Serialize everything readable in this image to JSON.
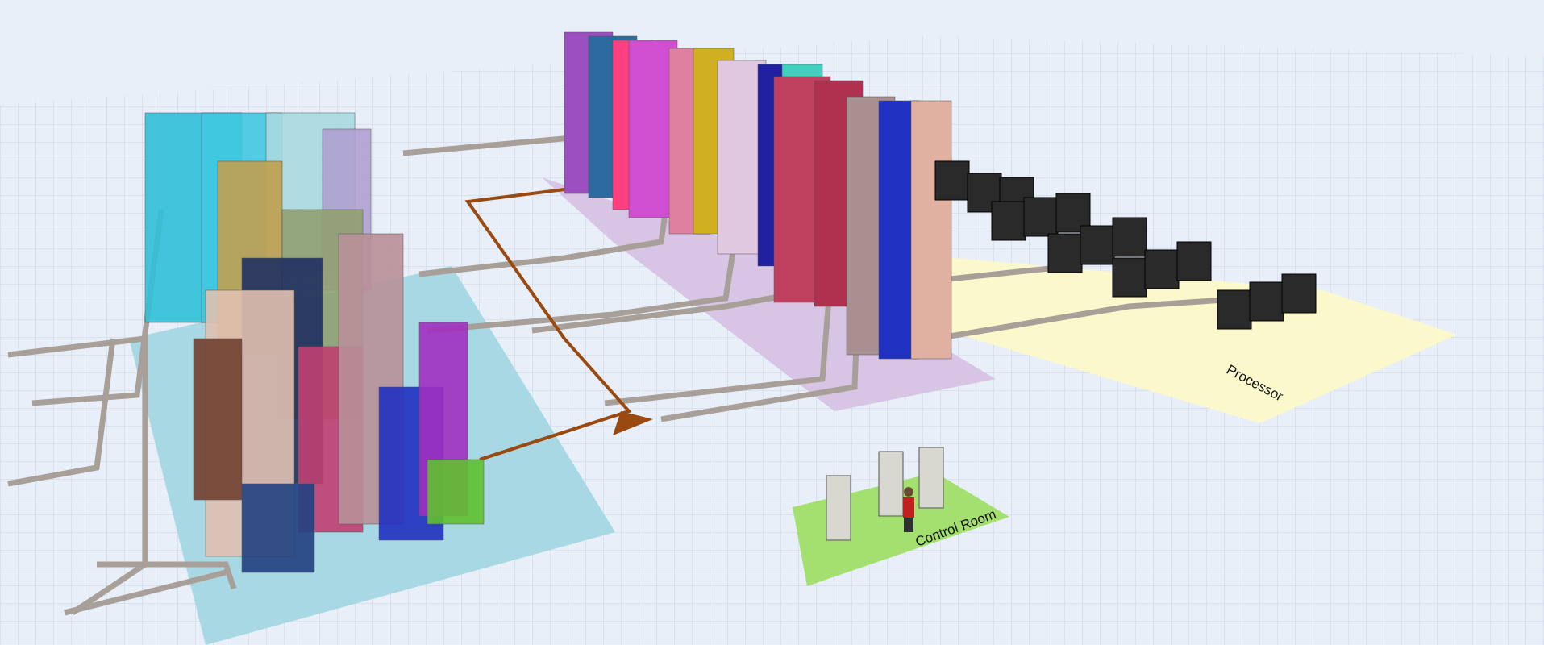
{
  "zone_labels": [
    {
      "text": "Processor"
    },
    {
      "text": "Control Room"
    }
  ]
}
